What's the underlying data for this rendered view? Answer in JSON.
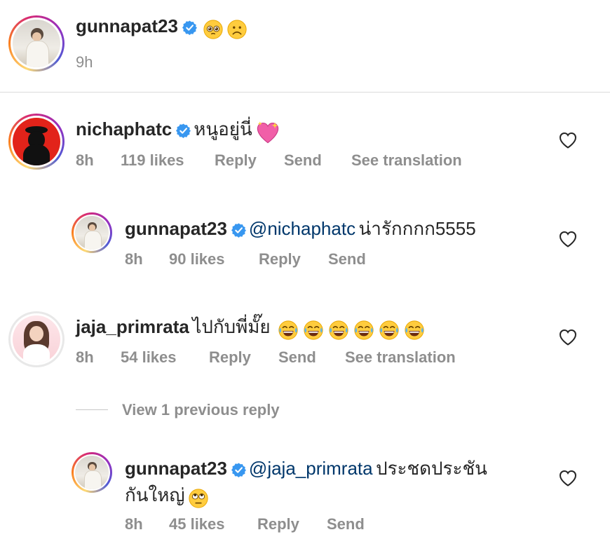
{
  "caption": {
    "username": "gunnapat23",
    "time": "9h",
    "emojis": [
      "pleading-face-emoji",
      "frowning-face-emoji"
    ]
  },
  "comments": [
    {
      "username": "nichaphatc",
      "verified": true,
      "text": "หนูอยู่นี่",
      "emoji": "sparkling-heart-emoji",
      "time": "8h",
      "likes": "119 likes",
      "reply": "Reply",
      "send": "Send",
      "translate": "See translation"
    },
    {
      "username": "gunnapat23",
      "verified": true,
      "mention": "@nichaphatc",
      "text": "น่ารักกกก5555",
      "time": "8h",
      "likes": "90 likes",
      "reply": "Reply",
      "send": "Send"
    },
    {
      "username": "jaja_primrata",
      "verified": false,
      "text": "ไปกับพี่มั๊ย",
      "emoji": "face-with-tears-of-joy-emoji",
      "emoji_count": 6,
      "time": "8h",
      "likes": "54 likes",
      "reply": "Reply",
      "send": "Send",
      "translate": "See translation"
    },
    {
      "username": "gunnapat23",
      "verified": true,
      "mention": "@jaja_primrata",
      "text_line1": "ประชดประชัน",
      "text_line2": "กันใหญ่",
      "emoji": "face-with-rolling-eyes-emoji",
      "time": "8h",
      "likes": "45 likes",
      "reply": "Reply",
      "send": "Send"
    }
  ],
  "view_replies": "View 1 previous reply",
  "colors": {
    "text": "#262626",
    "secondary": "#8e8e8e",
    "mention": "#00376b",
    "verified": "#3897f0",
    "divider": "#dbdbdb"
  }
}
